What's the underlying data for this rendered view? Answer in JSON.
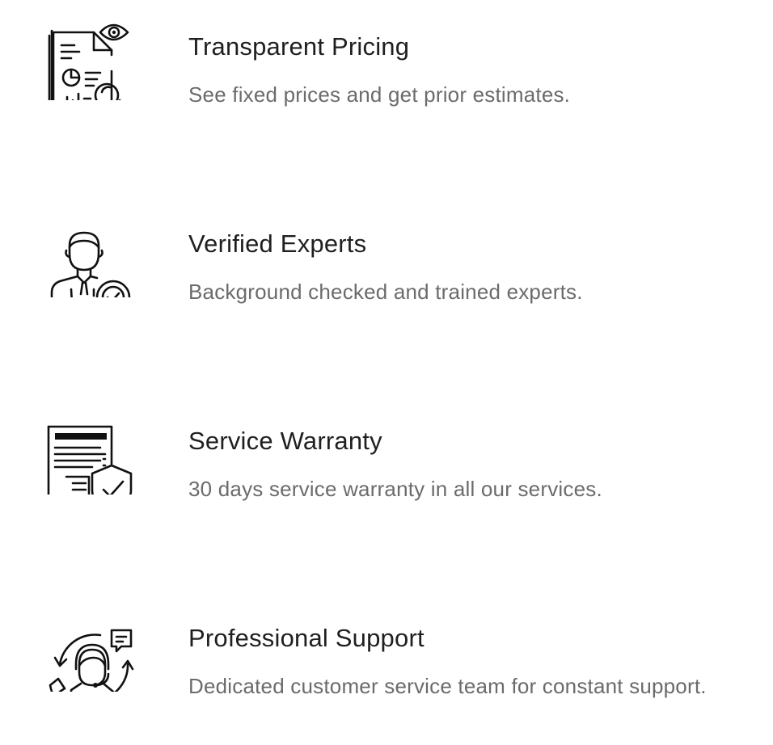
{
  "features": [
    {
      "icon": "document-analysis-icon",
      "title": "Transparent Pricing",
      "description": "See fixed prices and get prior estimates."
    },
    {
      "icon": "verified-expert-icon",
      "title": "Verified Experts",
      "description": "Background checked and trained experts."
    },
    {
      "icon": "warranty-document-shield-icon",
      "title": "Service Warranty",
      "description": "30 days service warranty in all our services."
    },
    {
      "icon": "customer-support-agent-icon",
      "title": "Professional Support",
      "description": "Dedicated customer service team for constant support."
    }
  ]
}
